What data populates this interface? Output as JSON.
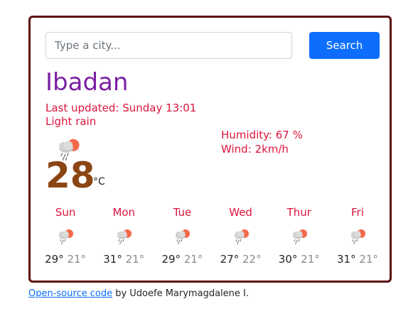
{
  "search": {
    "placeholder": "Type a city...",
    "value": "",
    "button_label": "Search"
  },
  "current": {
    "city": "Ibadan",
    "last_updated": "Last updated: Sunday 13:01",
    "description": "Light rain",
    "humidity": "Humidity: 67 %",
    "wind": "Wind: 2km/h",
    "temperature": "28",
    "unit": "°C",
    "icon": "rain-cloud-sun-icon"
  },
  "forecast": [
    {
      "day": "Sun",
      "max": "29°",
      "min": "21°",
      "icon": "rain-cloud-sun-icon"
    },
    {
      "day": "Mon",
      "max": "31°",
      "min": "21°",
      "icon": "rain-cloud-sun-icon"
    },
    {
      "day": "Tue",
      "max": "29°",
      "min": "21°",
      "icon": "rain-cloud-sun-icon"
    },
    {
      "day": "Wed",
      "max": "27°",
      "min": "22°",
      "icon": "rain-cloud-sun-icon"
    },
    {
      "day": "Thur",
      "max": "30°",
      "min": "21°",
      "icon": "rain-cloud-sun-icon"
    },
    {
      "day": "Fri",
      "max": "31°",
      "min": "21°",
      "icon": "rain-cloud-sun-icon"
    }
  ],
  "footer": {
    "link_text": "Open-source code",
    "suffix": " by Udoefe Marymagdalene I."
  },
  "colors": {
    "accent": "#0d6efd",
    "city": "#7b1fa2",
    "info": "#dc143c",
    "temperature": "#8b4513",
    "border": "#5c0f0f"
  }
}
